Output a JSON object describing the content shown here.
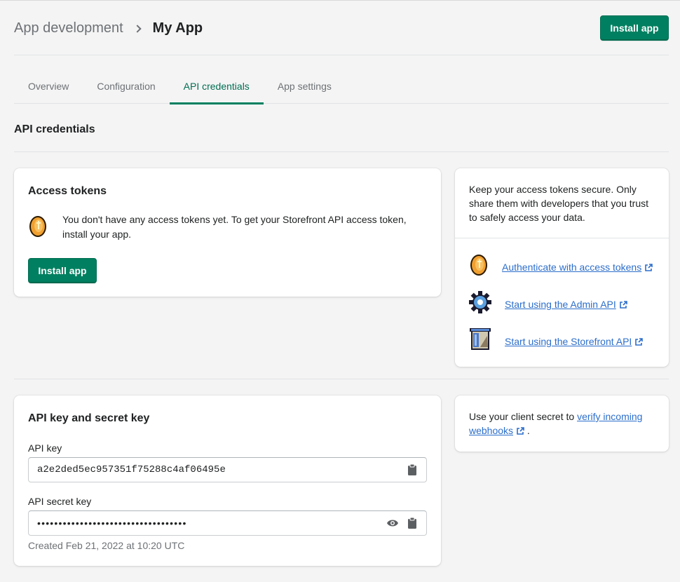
{
  "header": {
    "breadcrumb_parent": "App development",
    "title": "My App",
    "install_label": "Install app"
  },
  "tabs": [
    {
      "label": "Overview"
    },
    {
      "label": "Configuration"
    },
    {
      "label": "API credentials"
    },
    {
      "label": "App settings"
    }
  ],
  "section": {
    "title": "API credentials"
  },
  "access_tokens": {
    "title": "Access tokens",
    "message": "You don't have any access tokens yet. To get your Storefront API access token, install your app.",
    "install_label": "Install app",
    "icon": "coin-icon"
  },
  "side_tokens": {
    "text": "Keep your access tokens secure. Only share them with developers that you trust to safely access your data.",
    "links": [
      {
        "label": "Authenticate with access tokens",
        "icon": "coin-icon"
      },
      {
        "label": "Start using the Admin API",
        "icon": "gear-icon"
      },
      {
        "label": "Start using the Storefront API",
        "icon": "storefront-icon"
      }
    ]
  },
  "api_keys": {
    "title": "API key and secret key",
    "key_label": "API key",
    "key_value": "a2e2ded5ec957351f75288c4af06495e",
    "secret_label": "API secret key",
    "secret_mask": "•••••••••••••••••••••••••••••••••••",
    "created": "Created Feb 21, 2022 at 10:20 UTC"
  },
  "side_webhooks": {
    "text_before": "Use your client secret to ",
    "link_label": "verify incoming webhooks",
    "text_after": " ."
  },
  "colors": {
    "primary": "#008060",
    "link": "#2c6ecb",
    "active_tab": "#006e52"
  }
}
